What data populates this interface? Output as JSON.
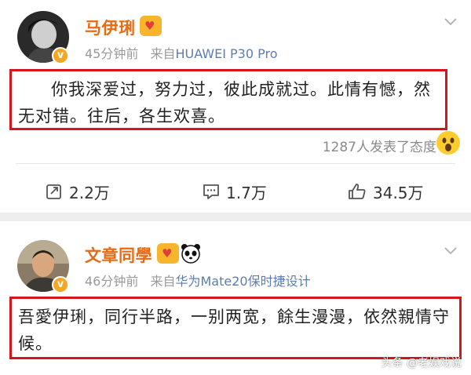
{
  "posts": [
    {
      "name": "马伊琍",
      "time": "45分钟前",
      "source_prefix": "来自",
      "source": "HUAWEI P30 Pro",
      "content": "你我深爱过，努力过，彼此成就过。此情有憾，然无对错。往后，各生欢喜。",
      "reactions_text": "1287人发表了态度",
      "actions": {
        "repost": "2.2万",
        "comment": "1.7万",
        "like": "34.5万"
      }
    },
    {
      "name": "文章同學",
      "time": "46分钟前",
      "source_prefix": "来自",
      "source": "华为Mate20保时捷设计",
      "content": "吾愛伊琍，同行半路，一别两宽，餘生漫漫，依然親情守候。"
    }
  ],
  "watermark": "头条 @老娱戏说",
  "colors": {
    "name": "#ea6a12",
    "source": "#5b7db1",
    "highlight_border": "#d8141c",
    "badge": "#f5a623"
  },
  "icons": [
    "verified-badge-icon",
    "crown-heart-badge-icon",
    "panda-icon",
    "chevron-down-icon",
    "surprised-emoji-icon",
    "repost-icon",
    "comment-icon",
    "like-icon"
  ]
}
